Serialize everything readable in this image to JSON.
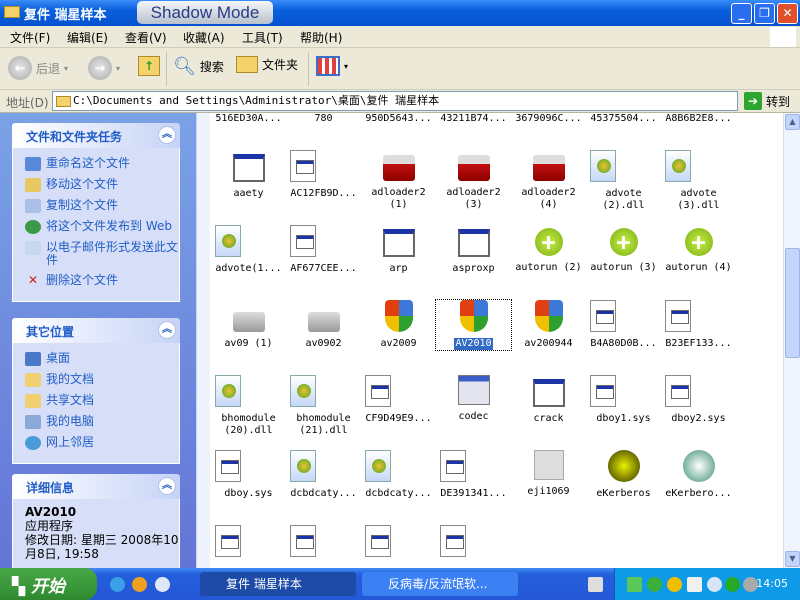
{
  "window": {
    "title": "复件 瑞星样本",
    "badge": "Shadow Mode",
    "minimize": "_",
    "restore": "❐",
    "close": "✕"
  },
  "menu": [
    "文件(F)",
    "编辑(E)",
    "查看(V)",
    "收藏(A)",
    "工具(T)",
    "帮助(H)"
  ],
  "toolbar": {
    "back": "后退",
    "search": "搜索",
    "folders": "文件夹"
  },
  "address": {
    "label": "地址(D)",
    "value": "C:\\Documents and Settings\\Administrator\\桌面\\复件 瑞星样本",
    "go": "转到"
  },
  "sidebar": {
    "tasks": {
      "title": "文件和文件夹任务",
      "items": [
        "重命名这个文件",
        "移动这个文件",
        "复制这个文件",
        "将这个文件发布到 Web",
        "以电子邮件形式发送此文件",
        "删除这个文件"
      ]
    },
    "places": {
      "title": "其它位置",
      "items": [
        "桌面",
        "我的文档",
        "共享文档",
        "我的电脑",
        "网上邻居"
      ]
    },
    "details": {
      "title": "详细信息",
      "name": "AV2010",
      "type": "应用程序",
      "modified": "修改日期: 星期三 2008年10月8日, 19:58"
    }
  },
  "files": [
    {
      "name": "516ED30A...",
      "icon": "doc"
    },
    {
      "name": "780",
      "icon": "window"
    },
    {
      "name": "950D5643...",
      "icon": "doc"
    },
    {
      "name": "43211B74...",
      "icon": "doc"
    },
    {
      "name": "3679096C...",
      "icon": "doc"
    },
    {
      "name": "45375504...",
      "icon": "doc"
    },
    {
      "name": "A8B6B2E8...",
      "icon": "doc"
    },
    {
      "name": "aaety",
      "icon": "window"
    },
    {
      "name": "AC12FB9D...",
      "icon": "doc"
    },
    {
      "name": "adloader2 (1)",
      "icon": "flash"
    },
    {
      "name": "adloader2 (3)",
      "icon": "flash"
    },
    {
      "name": "adloader2 (4)",
      "icon": "flash"
    },
    {
      "name": "advote (2).dll",
      "icon": "dll"
    },
    {
      "name": "advote (3).dll",
      "icon": "dll"
    },
    {
      "name": "advote(1...",
      "icon": "dll"
    },
    {
      "name": "AF677CEE...",
      "icon": "doc"
    },
    {
      "name": "arp",
      "icon": "window"
    },
    {
      "name": "asproxp",
      "icon": "window"
    },
    {
      "name": "autorun (2)",
      "icon": "plus"
    },
    {
      "name": "autorun (3)",
      "icon": "plus"
    },
    {
      "name": "autorun (4)",
      "icon": "plus"
    },
    {
      "name": "av09 (1)",
      "icon": "inst"
    },
    {
      "name": "av0902",
      "icon": "inst"
    },
    {
      "name": "av2009",
      "icon": "shield"
    },
    {
      "name": "AV2010",
      "icon": "shield",
      "selected": true
    },
    {
      "name": "av200944",
      "icon": "shield"
    },
    {
      "name": "B4A80D0B...",
      "icon": "doc"
    },
    {
      "name": "B23EF133...",
      "icon": "doc"
    },
    {
      "name": "bhomodule (20).dll",
      "icon": "dll"
    },
    {
      "name": "bhomodule (21).dll",
      "icon": "dll"
    },
    {
      "name": "CF9D49E9...",
      "icon": "doc"
    },
    {
      "name": "codec",
      "icon": "codec"
    },
    {
      "name": "crack",
      "icon": "window"
    },
    {
      "name": "dboy1.sys",
      "icon": "doc"
    },
    {
      "name": "dboy2.sys",
      "icon": "doc"
    },
    {
      "name": "dboy.sys",
      "icon": "doc"
    },
    {
      "name": "dcbdcaty...",
      "icon": "dll"
    },
    {
      "name": "dcbdcaty...",
      "icon": "dll"
    },
    {
      "name": "DE391341...",
      "icon": "doc"
    },
    {
      "name": "eji1069",
      "icon": "gen"
    },
    {
      "name": "eKerberos",
      "icon": "kerb"
    },
    {
      "name": "eKerbero...",
      "icon": "ekerb"
    },
    {
      "name": "",
      "icon": "doc"
    },
    {
      "name": "",
      "icon": "doc"
    },
    {
      "name": "",
      "icon": "doc"
    },
    {
      "name": "",
      "icon": "doc"
    }
  ],
  "taskbar": {
    "start": "开始",
    "tasks": [
      "复件 瑞星样本",
      "反病毒/反流氓软..."
    ],
    "clock": "14:05"
  }
}
